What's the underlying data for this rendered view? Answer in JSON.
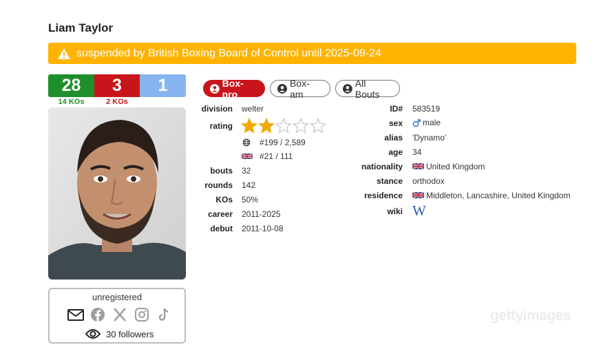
{
  "boxer": {
    "name": "Liam Taylor"
  },
  "banner": {
    "text": "suspended by British Boxing Board of Control until 2025-09-24",
    "color": "#ffb300"
  },
  "record": {
    "wins": "28",
    "losses": "3",
    "draws": "1",
    "wins_ko": "14 KOs",
    "losses_ko": "2 KOs",
    "colors": {
      "wins": "#1f8f2b",
      "losses": "#c8151b",
      "draws": "#86b4f0"
    }
  },
  "social": {
    "status": "unregistered",
    "icons": [
      "envelope-icon",
      "facebook-icon",
      "x-icon",
      "instagram-icon",
      "tiktok-icon"
    ],
    "followers": "30 followers"
  },
  "tabs": [
    {
      "label": "Box-pro",
      "active": true
    },
    {
      "label": "Box-am",
      "active": false
    },
    {
      "label": "All Bouts",
      "active": false
    }
  ],
  "left_details": {
    "division_label": "division",
    "division": "welter",
    "rating_label": "rating",
    "rating_stars": 2,
    "rating_max": 5,
    "world_rank": "#199 / 2,589",
    "country_rank": "#21 / 111",
    "bouts_label": "bouts",
    "bouts": "32",
    "rounds_label": "rounds",
    "rounds": "142",
    "kos_label": "KOs",
    "kos": "50%",
    "career_label": "career",
    "career": "2011-2025",
    "debut_label": "debut",
    "debut": "2011-10-08"
  },
  "right_details": {
    "id_label": "ID#",
    "id": "583519",
    "sex_label": "sex",
    "sex": "male",
    "alias_label": "alias",
    "alias": "'Dynamo'",
    "age_label": "age",
    "age": "34",
    "nationality_label": "nationality",
    "nationality": "United Kingdom",
    "stance_label": "stance",
    "stance": "orthodox",
    "residence_label": "residence",
    "residence": "Middleton, Lancashire, United Kingdom",
    "wiki_label": "wiki"
  },
  "watermark": "gettyimages"
}
